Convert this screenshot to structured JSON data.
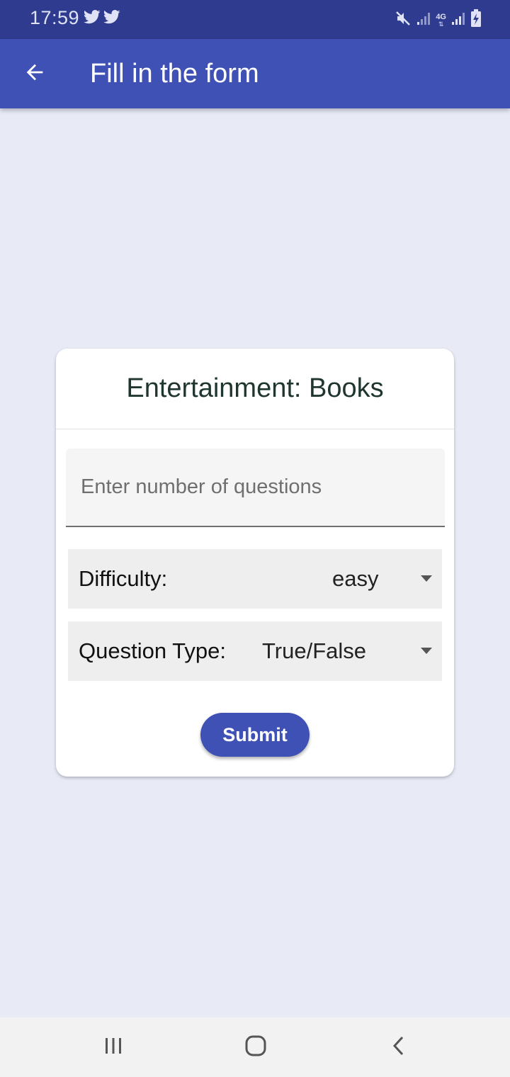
{
  "status_bar": {
    "time": "17:59",
    "left_icons": [
      "twitter-icon",
      "twitter-icon"
    ],
    "right_icons": [
      "mute-icon",
      "signal-icon",
      "4g-icon",
      "signal-icon",
      "battery-charging-icon"
    ],
    "network_label": "4G"
  },
  "app_bar": {
    "back_icon": "arrow-back-icon",
    "title": "Fill in the form",
    "color": "#3f51b5"
  },
  "card": {
    "title": "Entertainment: Books",
    "num_questions": {
      "value": "",
      "placeholder": "Enter number of questions"
    },
    "difficulty": {
      "label": "Difficulty:",
      "selected": "easy"
    },
    "question_type": {
      "label": "Question Type:",
      "selected": "True/False"
    },
    "submit_label": "Submit"
  },
  "nav_bar": {
    "icons": [
      "recent-apps-icon",
      "home-icon",
      "back-icon"
    ]
  }
}
